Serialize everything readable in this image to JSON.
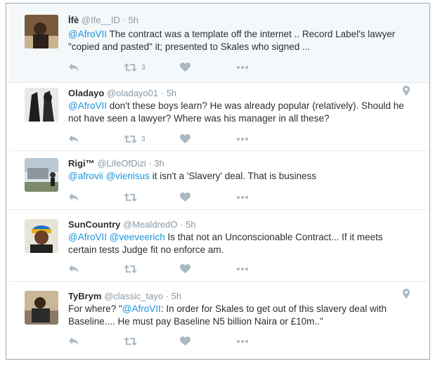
{
  "tweets": [
    {
      "name": "İfè",
      "handle": "@Ife__ID",
      "time": "· 5h",
      "text_parts": [
        "@AfroVII",
        " The contract was a template off the internet .. Record Label's lawyer \"copied and pasted\" it; presented to Skales who signed ..."
      ],
      "retweet_count": "3",
      "geo": false
    },
    {
      "name": "Oladayo",
      "handle": "@oladayo01",
      "time": "· 5h",
      "text_parts": [
        "@AfroVII",
        " don't these boys learn? He was already popular (relatively). Should he not have seen a lawyer? Where was his manager in all these?"
      ],
      "retweet_count": "3",
      "geo": true
    },
    {
      "name": "Rigi™",
      "handle": "@LifeOfDizi",
      "time": "· 3h",
      "text_parts": [
        "@afrovii @vienisus",
        " it isn't a 'Slavery' deal. That is business"
      ],
      "retweet_count": "",
      "geo": false
    },
    {
      "name": "SunCountry",
      "handle": "@MealdredO",
      "time": "· 5h",
      "text_parts": [
        "@AfroVII @veeveerich",
        " Is that not an Unconscionable Contract... If it meets certain tests Judge fit no enforce am."
      ],
      "retweet_count": "",
      "geo": false
    },
    {
      "name": "TyBrym",
      "handle": "@classic_tayo",
      "time": "· 5h",
      "text_parts": [
        "For where? \"",
        "@AfroVII",
        ": In order for Skales to get out of this slavery deal with Baseline.... He must pay Baseline N5 billion Naira or £10m..\""
      ],
      "retweet_count": "",
      "geo": true
    }
  ],
  "icons": {
    "reply": "reply-icon",
    "retweet": "retweet-icon",
    "like": "heart-icon",
    "more": "more-icon",
    "geo": "location-pin-icon"
  },
  "colors": {
    "mention": "#1b95e0",
    "name": "#292f33",
    "meta": "#8899a6",
    "action_icon": "#aab8c2",
    "highlight_bg": "#f5f8fa"
  }
}
